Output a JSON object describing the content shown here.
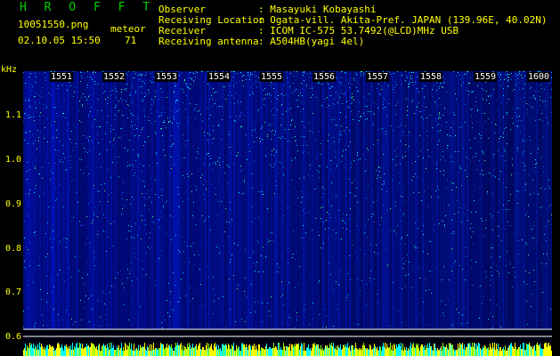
{
  "header": {
    "app_title": "H R O F F T",
    "filename": "10051550.png",
    "timestamp": "02.10.05 15:50",
    "meteor_label": "meteor",
    "meteor_count": "71"
  },
  "station": [
    {
      "label": "Observer",
      "value": ": Masayuki Kobayashi"
    },
    {
      "label": "Receiving Location",
      "value": ": Ogata-vill. Akita-Pref. JAPAN (139.96E, 40.02N)"
    },
    {
      "label": "Receiver",
      "value": ": ICOM IC-575 53.7492(@LCD)MHz USB"
    },
    {
      "label": "Receiving antenna",
      "value": ": A504HB(yagi 4el)"
    }
  ],
  "spectrogram": {
    "y_unit": "kHz",
    "y_ticks": [
      "1.1",
      "1.0",
      "0.9",
      "0.8",
      "0.7",
      "0.6"
    ],
    "x_ticks": [
      "1551",
      "1552",
      "1553",
      "1554",
      "1555",
      "1556",
      "1557",
      "1558",
      "1559",
      "1600"
    ]
  },
  "colors": {
    "background": "#000000",
    "label": "#ffff00",
    "title": "#00d000",
    "tick": "#ffffff"
  }
}
